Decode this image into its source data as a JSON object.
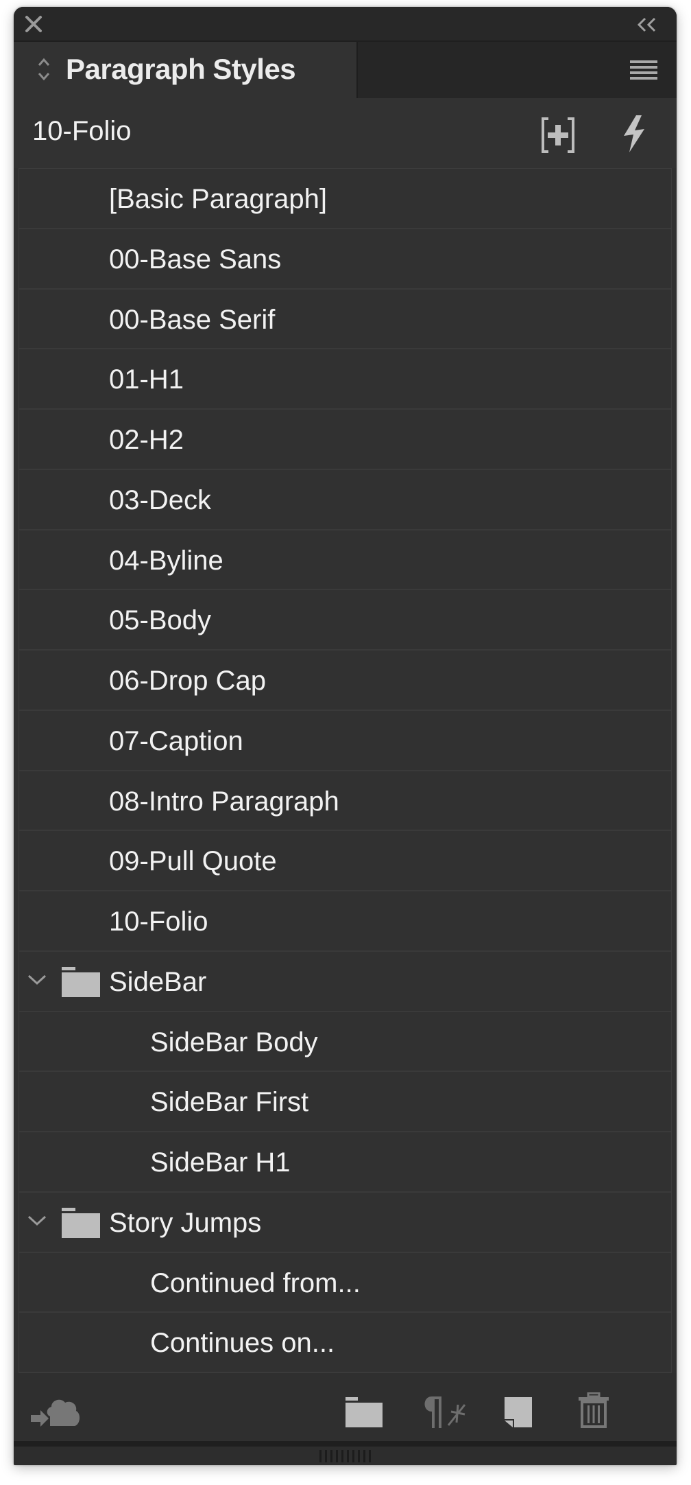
{
  "window": {
    "close_icon": "close-icon",
    "collapse_icon": "double-chevron-left-icon"
  },
  "tab": {
    "title": "Paragraph Styles",
    "icon": "up-down-chevron-icon",
    "menu_icon": "panel-menu-icon"
  },
  "header": {
    "current_style": "10-Folio",
    "new_group_icon": "new-style-group-icon",
    "quick_apply_icon": "lightning-icon"
  },
  "styles": [
    {
      "label": "[Basic Paragraph]",
      "type": "style",
      "level": 0
    },
    {
      "label": "00-Base Sans",
      "type": "style",
      "level": 0
    },
    {
      "label": "00-Base Serif",
      "type": "style",
      "level": 0
    },
    {
      "label": "01-H1",
      "type": "style",
      "level": 0
    },
    {
      "label": "02-H2",
      "type": "style",
      "level": 0
    },
    {
      "label": "03-Deck",
      "type": "style",
      "level": 0
    },
    {
      "label": "04-Byline",
      "type": "style",
      "level": 0
    },
    {
      "label": "05-Body",
      "type": "style",
      "level": 0
    },
    {
      "label": "06-Drop Cap",
      "type": "style",
      "level": 0
    },
    {
      "label": "07-Caption",
      "type": "style",
      "level": 0
    },
    {
      "label": "08-Intro Paragraph",
      "type": "style",
      "level": 0
    },
    {
      "label": "09-Pull Quote",
      "type": "style",
      "level": 0
    },
    {
      "label": "10-Folio",
      "type": "style",
      "level": 0
    },
    {
      "label": "SideBar",
      "type": "folder",
      "level": 0,
      "expanded": true
    },
    {
      "label": "SideBar Body",
      "type": "style",
      "level": 1
    },
    {
      "label": "SideBar First",
      "type": "style",
      "level": 1
    },
    {
      "label": "SideBar H1",
      "type": "style",
      "level": 1
    },
    {
      "label": "Story Jumps",
      "type": "folder",
      "level": 0,
      "expanded": true
    },
    {
      "label": "Continued from...",
      "type": "style",
      "level": 1
    },
    {
      "label": "Continues on...",
      "type": "style",
      "level": 1
    }
  ],
  "toolbar": {
    "cc_libraries_icon": "cloud-arrow-icon",
    "new_group_icon": "folder-icon",
    "clear_overrides_icon": "pilcrow-asterisk-icon",
    "new_style_icon": "new-page-icon",
    "delete_icon": "trash-icon"
  },
  "colors": {
    "panel_bg": "#303030",
    "titlebar_bg": "#282828",
    "text": "#f2f2f2",
    "icon_light": "#bdbdbd",
    "icon_dim": "#757575"
  }
}
